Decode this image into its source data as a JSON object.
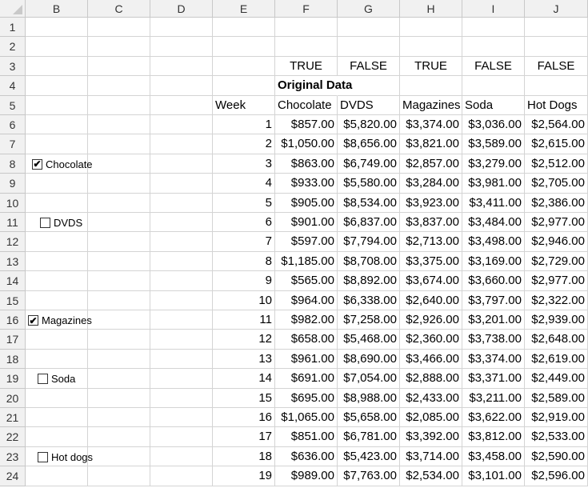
{
  "columns": [
    "B",
    "C",
    "D",
    "E",
    "F",
    "G",
    "H",
    "I",
    "J"
  ],
  "rows": [
    "1",
    "2",
    "3",
    "4",
    "5",
    "6",
    "7",
    "8",
    "9",
    "10",
    "11",
    "12",
    "13",
    "14",
    "15",
    "16",
    "17",
    "18",
    "19",
    "20",
    "21",
    "22",
    "23",
    "24"
  ],
  "flags": [
    "TRUE",
    "FALSE",
    "TRUE",
    "FALSE",
    "FALSE"
  ],
  "section_title": "Original Data",
  "headers": [
    "Week",
    "Chocolate",
    "DVDS",
    "Magazines",
    "Soda",
    "Hot Dogs"
  ],
  "data": [
    [
      "1",
      "$857.00",
      "$5,820.00",
      "$3,374.00",
      "$3,036.00",
      "$2,564.00"
    ],
    [
      "2",
      "$1,050.00",
      "$8,656.00",
      "$3,821.00",
      "$3,589.00",
      "$2,615.00"
    ],
    [
      "3",
      "$863.00",
      "$6,749.00",
      "$2,857.00",
      "$3,279.00",
      "$2,512.00"
    ],
    [
      "4",
      "$933.00",
      "$5,580.00",
      "$3,284.00",
      "$3,981.00",
      "$2,705.00"
    ],
    [
      "5",
      "$905.00",
      "$8,534.00",
      "$3,923.00",
      "$3,411.00",
      "$2,386.00"
    ],
    [
      "6",
      "$901.00",
      "$6,837.00",
      "$3,837.00",
      "$3,484.00",
      "$2,977.00"
    ],
    [
      "7",
      "$597.00",
      "$7,794.00",
      "$2,713.00",
      "$3,498.00",
      "$2,946.00"
    ],
    [
      "8",
      "$1,185.00",
      "$8,708.00",
      "$3,375.00",
      "$3,169.00",
      "$2,729.00"
    ],
    [
      "9",
      "$565.00",
      "$8,892.00",
      "$3,674.00",
      "$3,660.00",
      "$2,977.00"
    ],
    [
      "10",
      "$964.00",
      "$6,338.00",
      "$2,640.00",
      "$3,797.00",
      "$2,322.00"
    ],
    [
      "11",
      "$982.00",
      "$7,258.00",
      "$2,926.00",
      "$3,201.00",
      "$2,939.00"
    ],
    [
      "12",
      "$658.00",
      "$5,468.00",
      "$2,360.00",
      "$3,738.00",
      "$2,648.00"
    ],
    [
      "13",
      "$961.00",
      "$8,690.00",
      "$3,466.00",
      "$3,374.00",
      "$2,619.00"
    ],
    [
      "14",
      "$691.00",
      "$7,054.00",
      "$2,888.00",
      "$3,371.00",
      "$2,449.00"
    ],
    [
      "15",
      "$695.00",
      "$8,988.00",
      "$2,433.00",
      "$3,211.00",
      "$2,589.00"
    ],
    [
      "16",
      "$1,065.00",
      "$5,658.00",
      "$2,085.00",
      "$3,622.00",
      "$2,919.00"
    ],
    [
      "17",
      "$851.00",
      "$6,781.00",
      "$3,392.00",
      "$3,812.00",
      "$2,533.00"
    ],
    [
      "18",
      "$636.00",
      "$5,423.00",
      "$3,714.00",
      "$3,458.00",
      "$2,590.00"
    ],
    [
      "19",
      "$989.00",
      "$7,763.00",
      "$2,534.00",
      "$3,101.00",
      "$2,596.00"
    ]
  ],
  "checkboxes": [
    {
      "label": "Chocolate",
      "checked": true,
      "mark": "✔"
    },
    {
      "label": "DVDS",
      "checked": false,
      "mark": ""
    },
    {
      "label": "Magazines",
      "checked": true,
      "mark": "✔"
    },
    {
      "label": "Soda",
      "checked": false,
      "mark": ""
    },
    {
      "label": "Hot dogs",
      "checked": false,
      "mark": ""
    }
  ]
}
